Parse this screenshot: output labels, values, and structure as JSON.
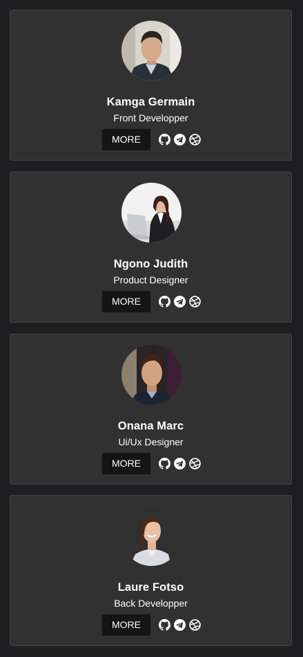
{
  "team": [
    {
      "name": "Kamga Germain",
      "role": "Front Developper",
      "button": "MORE"
    },
    {
      "name": "Ngono Judith",
      "role": "Product Designer",
      "button": "MORE"
    },
    {
      "name": "Onana Marc",
      "role": "Ui/Ux Designer",
      "button": "MORE"
    },
    {
      "name": "Laure Fotso",
      "role": "Back Developper",
      "button": "MORE"
    }
  ],
  "icons": [
    "github-icon",
    "telegram-icon",
    "dribbble-icon"
  ],
  "colors": {
    "page_background": "#1d1e20",
    "card_background": "#313131",
    "button_background": "#151515",
    "text": "#ffffff"
  }
}
